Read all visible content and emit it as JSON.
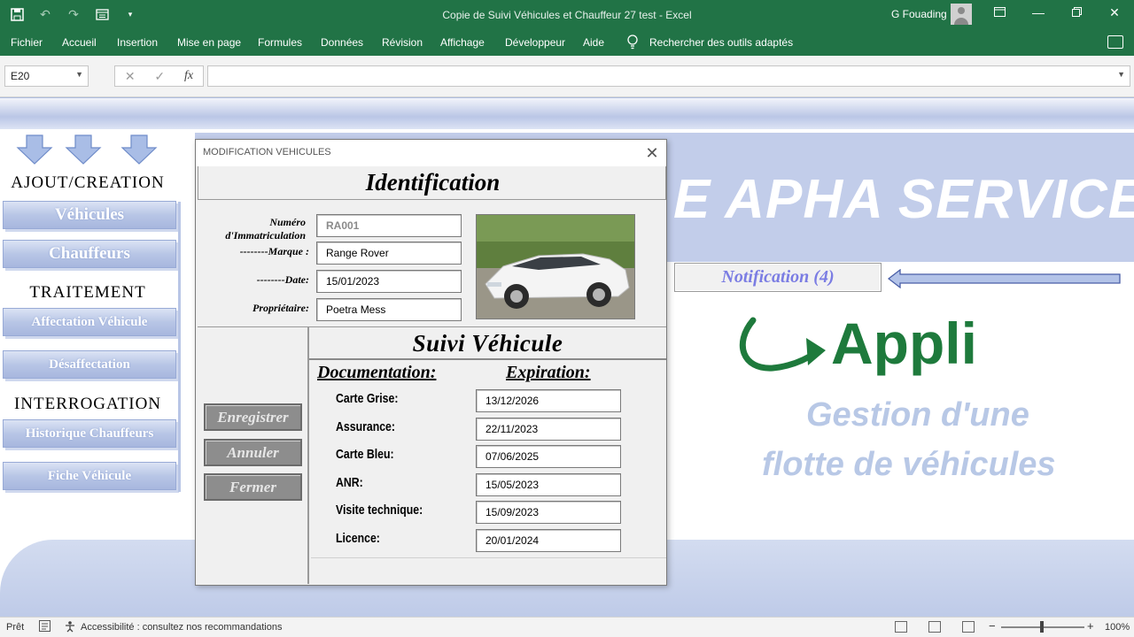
{
  "window": {
    "title": "Copie de Suivi Véhicules et Chauffeur 27  test  -  Excel",
    "user": "G Fouading"
  },
  "menu": [
    "Fichier",
    "Accueil",
    "Insertion",
    "Mise en page",
    "Formules",
    "Données",
    "Révision",
    "Affichage",
    "Développeur",
    "Aide"
  ],
  "search_tools": "Rechercher des outils adaptés",
  "formula": {
    "namebox": "E20",
    "content": ""
  },
  "sheet": {
    "banner": "E APHA SERVICES",
    "ajout_header": "AJOUT/CREATION",
    "traitement_header": "TRAITEMENT",
    "interrogation_header": "INTERROGATION",
    "buttons": {
      "vehicules": "Véhicules",
      "chauffeurs": "Chauffeurs",
      "affectation": "Affectation Véhicule",
      "desaffectation": "Désaffectation",
      "historique": "Historique Chauffeurs",
      "fiche": "Fiche Véhicule"
    },
    "notification": "Notification (4)",
    "appli": "Appli",
    "gestion_line1": "Gestion d'une",
    "gestion_line2": "flotte de véhicules"
  },
  "dialog": {
    "title": "MODIFICATION VEHICULES",
    "identification_title": "Identification",
    "labels": {
      "numero": "Numéro",
      "immatriculation": "d'Immatriculation",
      "marque": "--------Marque :",
      "date": "--------Date:",
      "proprietaire": "Propriétaire:"
    },
    "values": {
      "numero": "RA001",
      "marque": "Range Rover",
      "date": "15/01/2023",
      "proprietaire": "Poetra Mess"
    },
    "suivi_title": "Suivi  Véhicule",
    "documentation_header": "Documentation:",
    "expiration_header": "Expiration:",
    "documents": [
      {
        "label": "Carte Grise:",
        "value": "13/12/2026"
      },
      {
        "label": "Assurance:",
        "value": "22/11/2023"
      },
      {
        "label": "Carte Bleu:",
        "value": "07/06/2025"
      },
      {
        "label": "ANR:",
        "value": "15/05/2023"
      },
      {
        "label": "Visite technique:",
        "value": "15/09/2023"
      },
      {
        "label": "Licence:",
        "value": "20/01/2024"
      }
    ],
    "actions": {
      "enregistrer": "Enregistrer",
      "annuler": "Annuler",
      "fermer": "Fermer"
    }
  },
  "status": {
    "ready": "Prêt",
    "accessibility": "Accessibilité : consultez nos recommandations",
    "zoom": "100%"
  },
  "colors": {
    "excel_green": "#217346",
    "sheet_blue": "#c2cdea",
    "notification_text": "#7b7de3",
    "appli_green": "#1e7a3c"
  },
  "icons": [
    "save-icon",
    "undo-icon",
    "redo-icon",
    "form-icon",
    "lightbulb-icon",
    "comment-icon",
    "close-icon",
    "arrow-down-icon",
    "arrow-left-icon",
    "curved-arrow-icon"
  ]
}
